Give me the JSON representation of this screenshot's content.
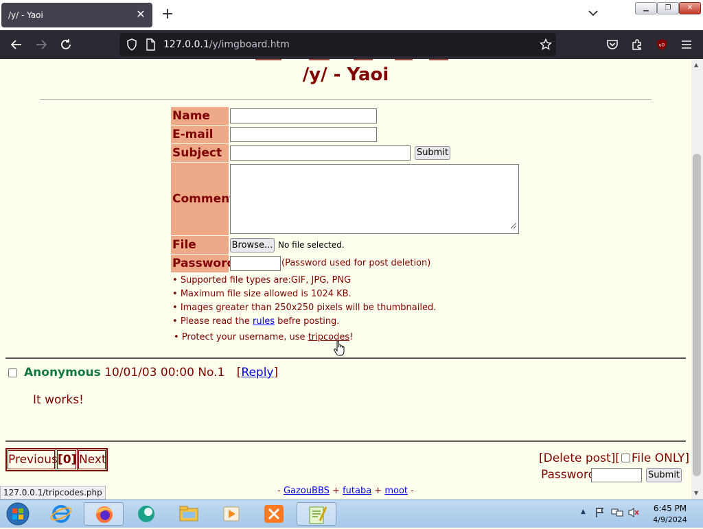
{
  "browser": {
    "tab_title": "/y/ - Yaoi",
    "url_host": "127.0.0.1",
    "url_path": "/y/imgboard.htm",
    "status_url": "127.0.0.1/tripcodes.php"
  },
  "board": {
    "title": "/y/ - Yaoi"
  },
  "form": {
    "name_label": "Name",
    "email_label": "E-mail",
    "subject_label": "Subject",
    "submit_label": "Submit",
    "comment_label": "Comment",
    "file_label": "File",
    "browse_label": "Browse...",
    "no_file": "No file selected.",
    "password_label": "Password",
    "password_hint": "(Password used for post deletion)"
  },
  "rules": [
    {
      "text": "Supported file types are:GIF, JPG, PNG"
    },
    {
      "text": "Maximum file size allowed is 1024 KB."
    },
    {
      "text": "Images greater than 250x250 pixels will be thumbnailed."
    },
    {
      "pre": "Please read the ",
      "link": "rules",
      "post": " befre posting."
    },
    {
      "pre": "Protect your username, use ",
      "link": "tripcodes",
      "post": "!"
    }
  ],
  "post": {
    "name": "Anonymous",
    "datetime": "10/01/03 00:00",
    "number": "No.1",
    "reply_open": "[",
    "reply_label": "Reply",
    "reply_close": "]",
    "comment": "It works!"
  },
  "pager": {
    "previous": "Previous",
    "current": "0",
    "next": "Next"
  },
  "delete": {
    "prefix": "[Delete post][",
    "file_only": "File ONLY]",
    "password_label": "Password",
    "submit_label": "Submit"
  },
  "footer": {
    "lead": "- ",
    "link1": "GazouBBS",
    "sep1": " + ",
    "link2": "futaba",
    "sep2": " + ",
    "link3": "moot",
    "tail": " -"
  },
  "taskbar": {
    "time": "6:45 PM",
    "date": "4/9/2024"
  },
  "colors": {
    "page_bg": "#ffffee",
    "label_bg": "#eeaa88",
    "text": "#800000",
    "poster_name": "#117743",
    "link": "#0000ee"
  }
}
